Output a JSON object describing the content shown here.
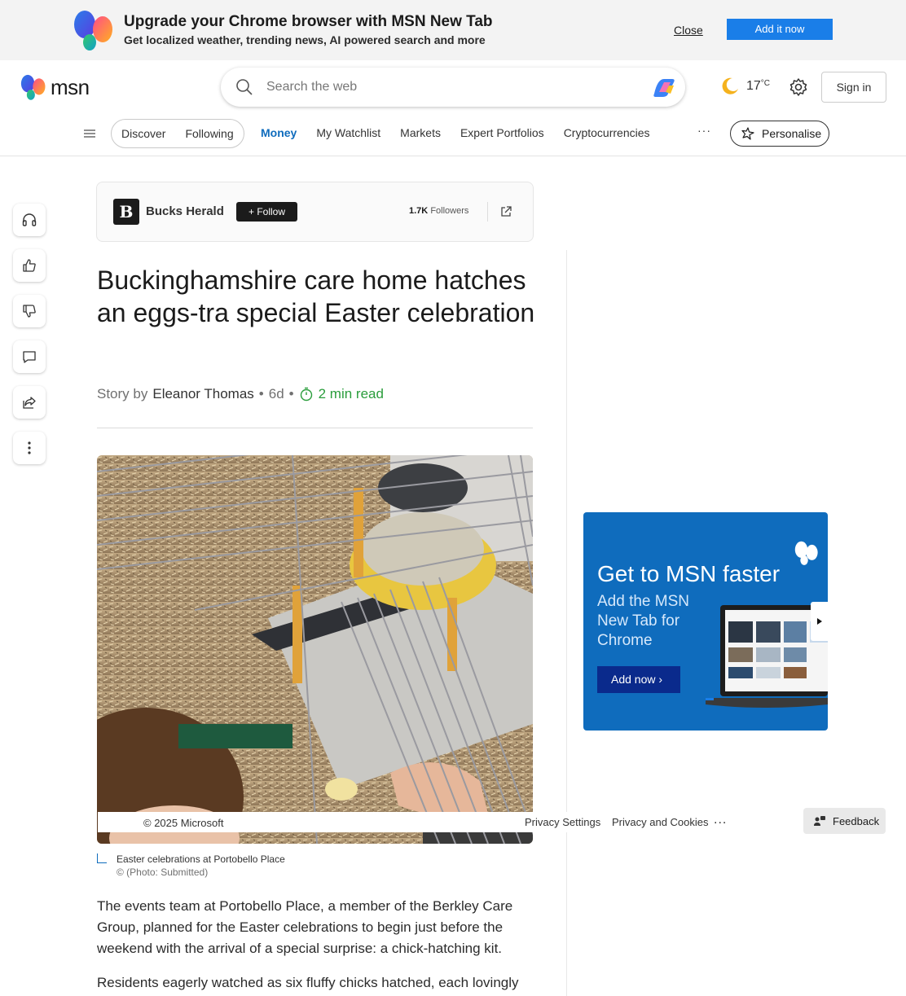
{
  "promo": {
    "title": "Upgrade your Chrome browser with MSN New Tab",
    "subtitle": "Get localized weather, trending news, AI powered search and more",
    "close_label": "Close",
    "add_label": "Add it now"
  },
  "header": {
    "brand": "msn",
    "search_placeholder": "Search the web",
    "weather_temp": "17",
    "weather_unit": "°C",
    "signin_label": "Sign in"
  },
  "nav": {
    "pills": [
      "Discover",
      "Following"
    ],
    "links": [
      "Money",
      "My Watchlist",
      "Markets",
      "Expert Portfolios",
      "Cryptocurrencies"
    ],
    "active": "Money",
    "more": "···",
    "personalise_label": "Personalise"
  },
  "rail": [
    "headphones-icon",
    "thumbs-up-icon",
    "thumbs-down-icon",
    "comment-icon",
    "share-icon",
    "more-vertical-icon"
  ],
  "publisher": {
    "logo_letter": "B",
    "name": "Bucks Herald",
    "follow_label": "Follow",
    "followers_count": "1.7K",
    "followers_label": "Followers"
  },
  "article": {
    "headline": "Buckinghamshire care home hatches an eggs-tra special Easter celebration",
    "story_by": "Story by",
    "author": "Eleanor Thomas",
    "age": "6d",
    "read_time": "2 min read",
    "caption": "Easter celebrations at Portobello Place",
    "credit": "© (Photo: Submitted)",
    "paragraphs": [
      "The events team at Portobello Place, a member of the Berkley Care Group, planned for the Easter celebrations to begin just before the weekend with the arrival of a special surprise: a chick-hatching kit.",
      "Residents eagerly watched as six fluffy chicks hatched, each lovingly"
    ]
  },
  "ad": {
    "title": "Get to MSN faster",
    "subtitle": "Add the MSN New Tab for Chrome",
    "button_label": "Add now"
  },
  "footer": {
    "copyright": "© 2025 Microsoft",
    "privacy_settings": "Privacy Settings",
    "privacy_cookies": "Privacy and Cookies",
    "more": "...",
    "feedback_label": "Feedback"
  },
  "colors": {
    "accent": "#0f6cbd",
    "promo_button": "#1a7ee8",
    "read_time": "#2a9d3c"
  }
}
